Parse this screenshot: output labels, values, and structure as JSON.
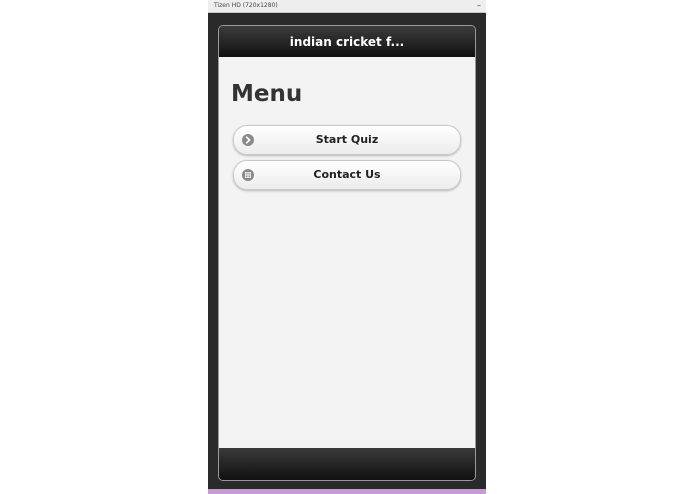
{
  "window": {
    "title": "Tizen HD (720x1280)",
    "minimize_glyph": "–"
  },
  "app": {
    "header_title": "indian cricket f...",
    "page_title": "Menu",
    "menu_items": [
      {
        "label": "Start Quiz",
        "icon": "arrow-right-circle-icon"
      },
      {
        "label": "Contact Us",
        "icon": "grid-circle-icon"
      }
    ]
  },
  "colors": {
    "header_bg": "#1a1a1a",
    "content_bg": "#f3f3f3",
    "accent_bottom": "#c69ad9"
  }
}
